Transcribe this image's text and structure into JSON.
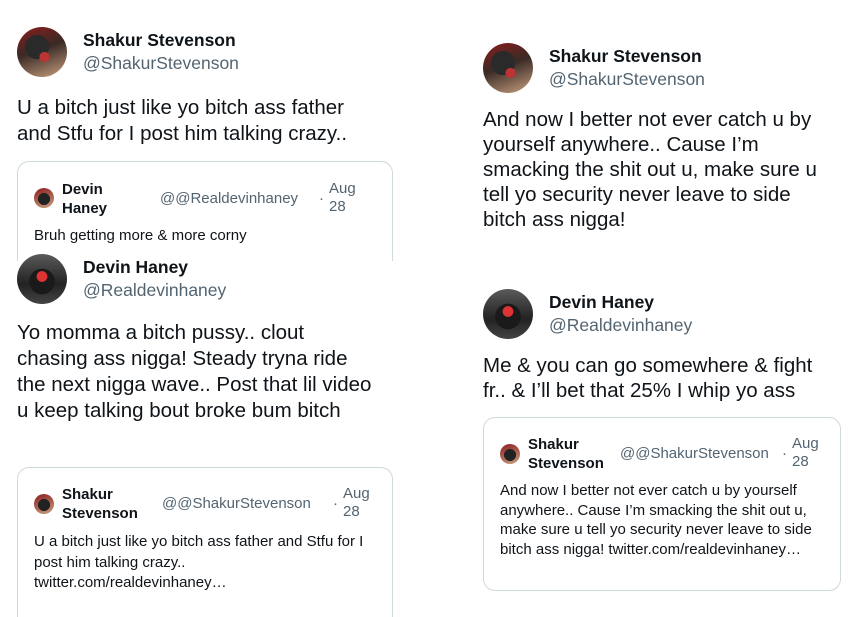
{
  "tweets": [
    {
      "name": "Shakur Stevenson",
      "handle": "@ShakurStevenson",
      "text": "U a bitch just like yo bitch ass father and Stfu for I post him talking crazy..",
      "quote": {
        "name": "Devin Haney",
        "handle": "@@Realdevinhaney",
        "dot": "·",
        "date": "Aug 28",
        "text": "Bruh getting more & more corny"
      }
    },
    {
      "name": "Shakur Stevenson",
      "handle": "@ShakurStevenson",
      "text": "And now I better not ever catch u by yourself anywhere.. Cause I’m smacking the shit out u, make sure u tell yo security never leave to side bitch ass nigga!"
    },
    {
      "name": "Devin Haney",
      "handle": "@Realdevinhaney",
      "text": "Yo momma a bitch pussy.. clout chasing ass nigga! Steady tryna ride the next nigga wave.. Post that lil video u keep talking bout broke bum bitch",
      "quote": {
        "name": "Shakur Stevenson",
        "handle": "@@ShakurStevenson",
        "dot": "·",
        "date": "Aug 28",
        "text": "U a bitch just like yo bitch ass father and Stfu for I post him talking crazy.. twitter.com/realdevinhaney…"
      }
    },
    {
      "name": "Devin Haney",
      "handle": "@Realdevinhaney",
      "text": "Me & you can go somewhere & fight fr.. & I’ll bet that 25% I whip yo ass",
      "quote": {
        "name": "Shakur Stevenson",
        "handle": "@@ShakurStevenson",
        "dot": "·",
        "date": "Aug 28",
        "text": "And now I better not ever catch u by yourself anywhere.. Cause I’m smacking the shit out u, make sure u tell yo security never leave to side bitch ass nigga! twitter.com/realdevinhaney…"
      }
    }
  ]
}
